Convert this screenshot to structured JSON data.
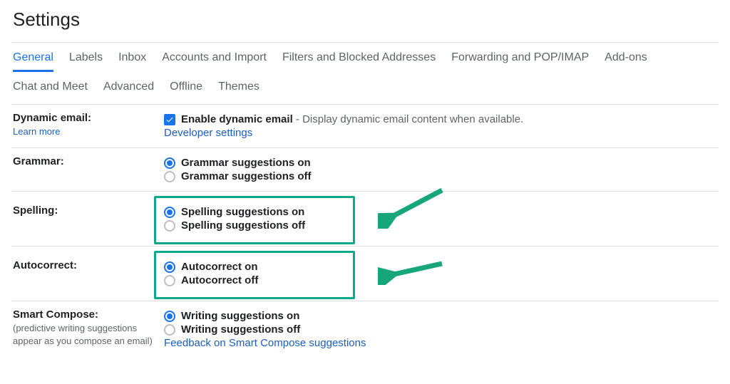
{
  "title": "Settings",
  "tabs_row1": [
    {
      "label": "General",
      "active": true
    },
    {
      "label": "Labels",
      "active": false
    },
    {
      "label": "Inbox",
      "active": false
    },
    {
      "label": "Accounts and Import",
      "active": false
    },
    {
      "label": "Filters and Blocked Addresses",
      "active": false
    },
    {
      "label": "Forwarding and POP/IMAP",
      "active": false
    },
    {
      "label": "Add-ons",
      "active": false
    }
  ],
  "tabs_row2": [
    {
      "label": "Chat and Meet",
      "active": false
    },
    {
      "label": "Advanced",
      "active": false
    },
    {
      "label": "Offline",
      "active": false
    },
    {
      "label": "Themes",
      "active": false
    }
  ],
  "dynamic_email": {
    "label": "Dynamic email:",
    "learn_more": "Learn more",
    "checkbox_label": "Enable dynamic email",
    "checkbox_desc": " - Display dynamic email content when available.",
    "dev_link": "Developer settings"
  },
  "grammar": {
    "label": "Grammar:",
    "on": "Grammar suggestions on",
    "off": "Grammar suggestions off"
  },
  "spelling": {
    "label": "Spelling:",
    "on": "Spelling suggestions on",
    "off": "Spelling suggestions off"
  },
  "autocorrect": {
    "label": "Autocorrect:",
    "on": "Autocorrect on",
    "off": "Autocorrect off"
  },
  "smart_compose": {
    "label": "Smart Compose:",
    "sub": "(predictive writing suggestions appear as you compose an email)",
    "on": "Writing suggestions on",
    "off": "Writing suggestions off",
    "feedback": "Feedback on Smart Compose suggestions"
  },
  "colors": {
    "highlight": "#0ea88a",
    "arrow": "#17a679",
    "link": "#1a73e8"
  }
}
